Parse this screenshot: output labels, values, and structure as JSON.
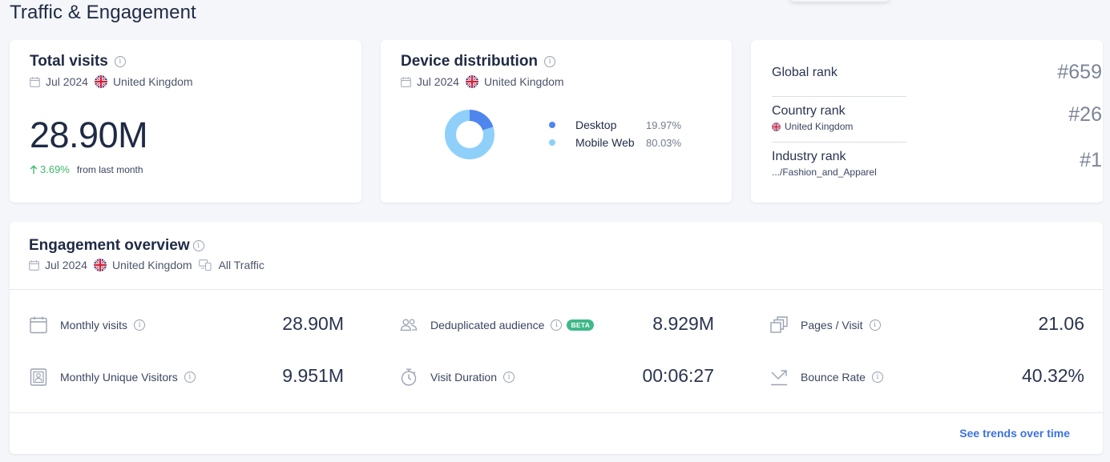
{
  "page_title": "Traffic & Engagement",
  "colors": {
    "desktop": "#4f86ee",
    "mobile_web": "#8fd0fb",
    "positive": "#3fb86a",
    "link": "#3a72e0",
    "beta": "#3fb88a"
  },
  "total_visits": {
    "title": "Total visits",
    "period": "Jul 2024",
    "country": "United Kingdom",
    "value": "28.90M",
    "change_pct": "3.69%",
    "change_text": "from last month",
    "change_direction": "up"
  },
  "device_distribution": {
    "title": "Device distribution",
    "period": "Jul 2024",
    "country": "United Kingdom",
    "segments": [
      {
        "label": "Desktop",
        "value_text": "19.97%",
        "share": 19.97
      },
      {
        "label": "Mobile Web",
        "value_text": "80.03%",
        "share": 80.03
      }
    ]
  },
  "ranks": [
    {
      "label": "Global rank",
      "sub": "",
      "value": "#659"
    },
    {
      "label": "Country rank",
      "sub": "United Kingdom",
      "value": "#26"
    },
    {
      "label": "Industry rank",
      "sub": ".../Fashion_and_Apparel",
      "value": "#1"
    }
  ],
  "engagement": {
    "title": "Engagement overview",
    "period": "Jul 2024",
    "country": "United Kingdom",
    "traffic": "All Traffic",
    "metrics": {
      "monthly_visits": {
        "label": "Monthly visits",
        "value": "28.90M",
        "icon": "calendar-icon"
      },
      "deduplicated_audience": {
        "label": "Deduplicated audience",
        "value": "8.929M",
        "badge": "BETA",
        "icon": "people-icon"
      },
      "pages_per_visit": {
        "label": "Pages / Visit",
        "value": "21.06",
        "icon": "pages-icon"
      },
      "monthly_unique_visitors": {
        "label": "Monthly Unique Visitors",
        "value": "9.951M",
        "icon": "contact-card-icon"
      },
      "visit_duration": {
        "label": "Visit Duration",
        "value": "00:06:27",
        "icon": "stopwatch-icon"
      },
      "bounce_rate": {
        "label": "Bounce Rate",
        "value": "40.32%",
        "icon": "bounce-arrow-icon"
      }
    },
    "trends_link": "See trends over time"
  }
}
